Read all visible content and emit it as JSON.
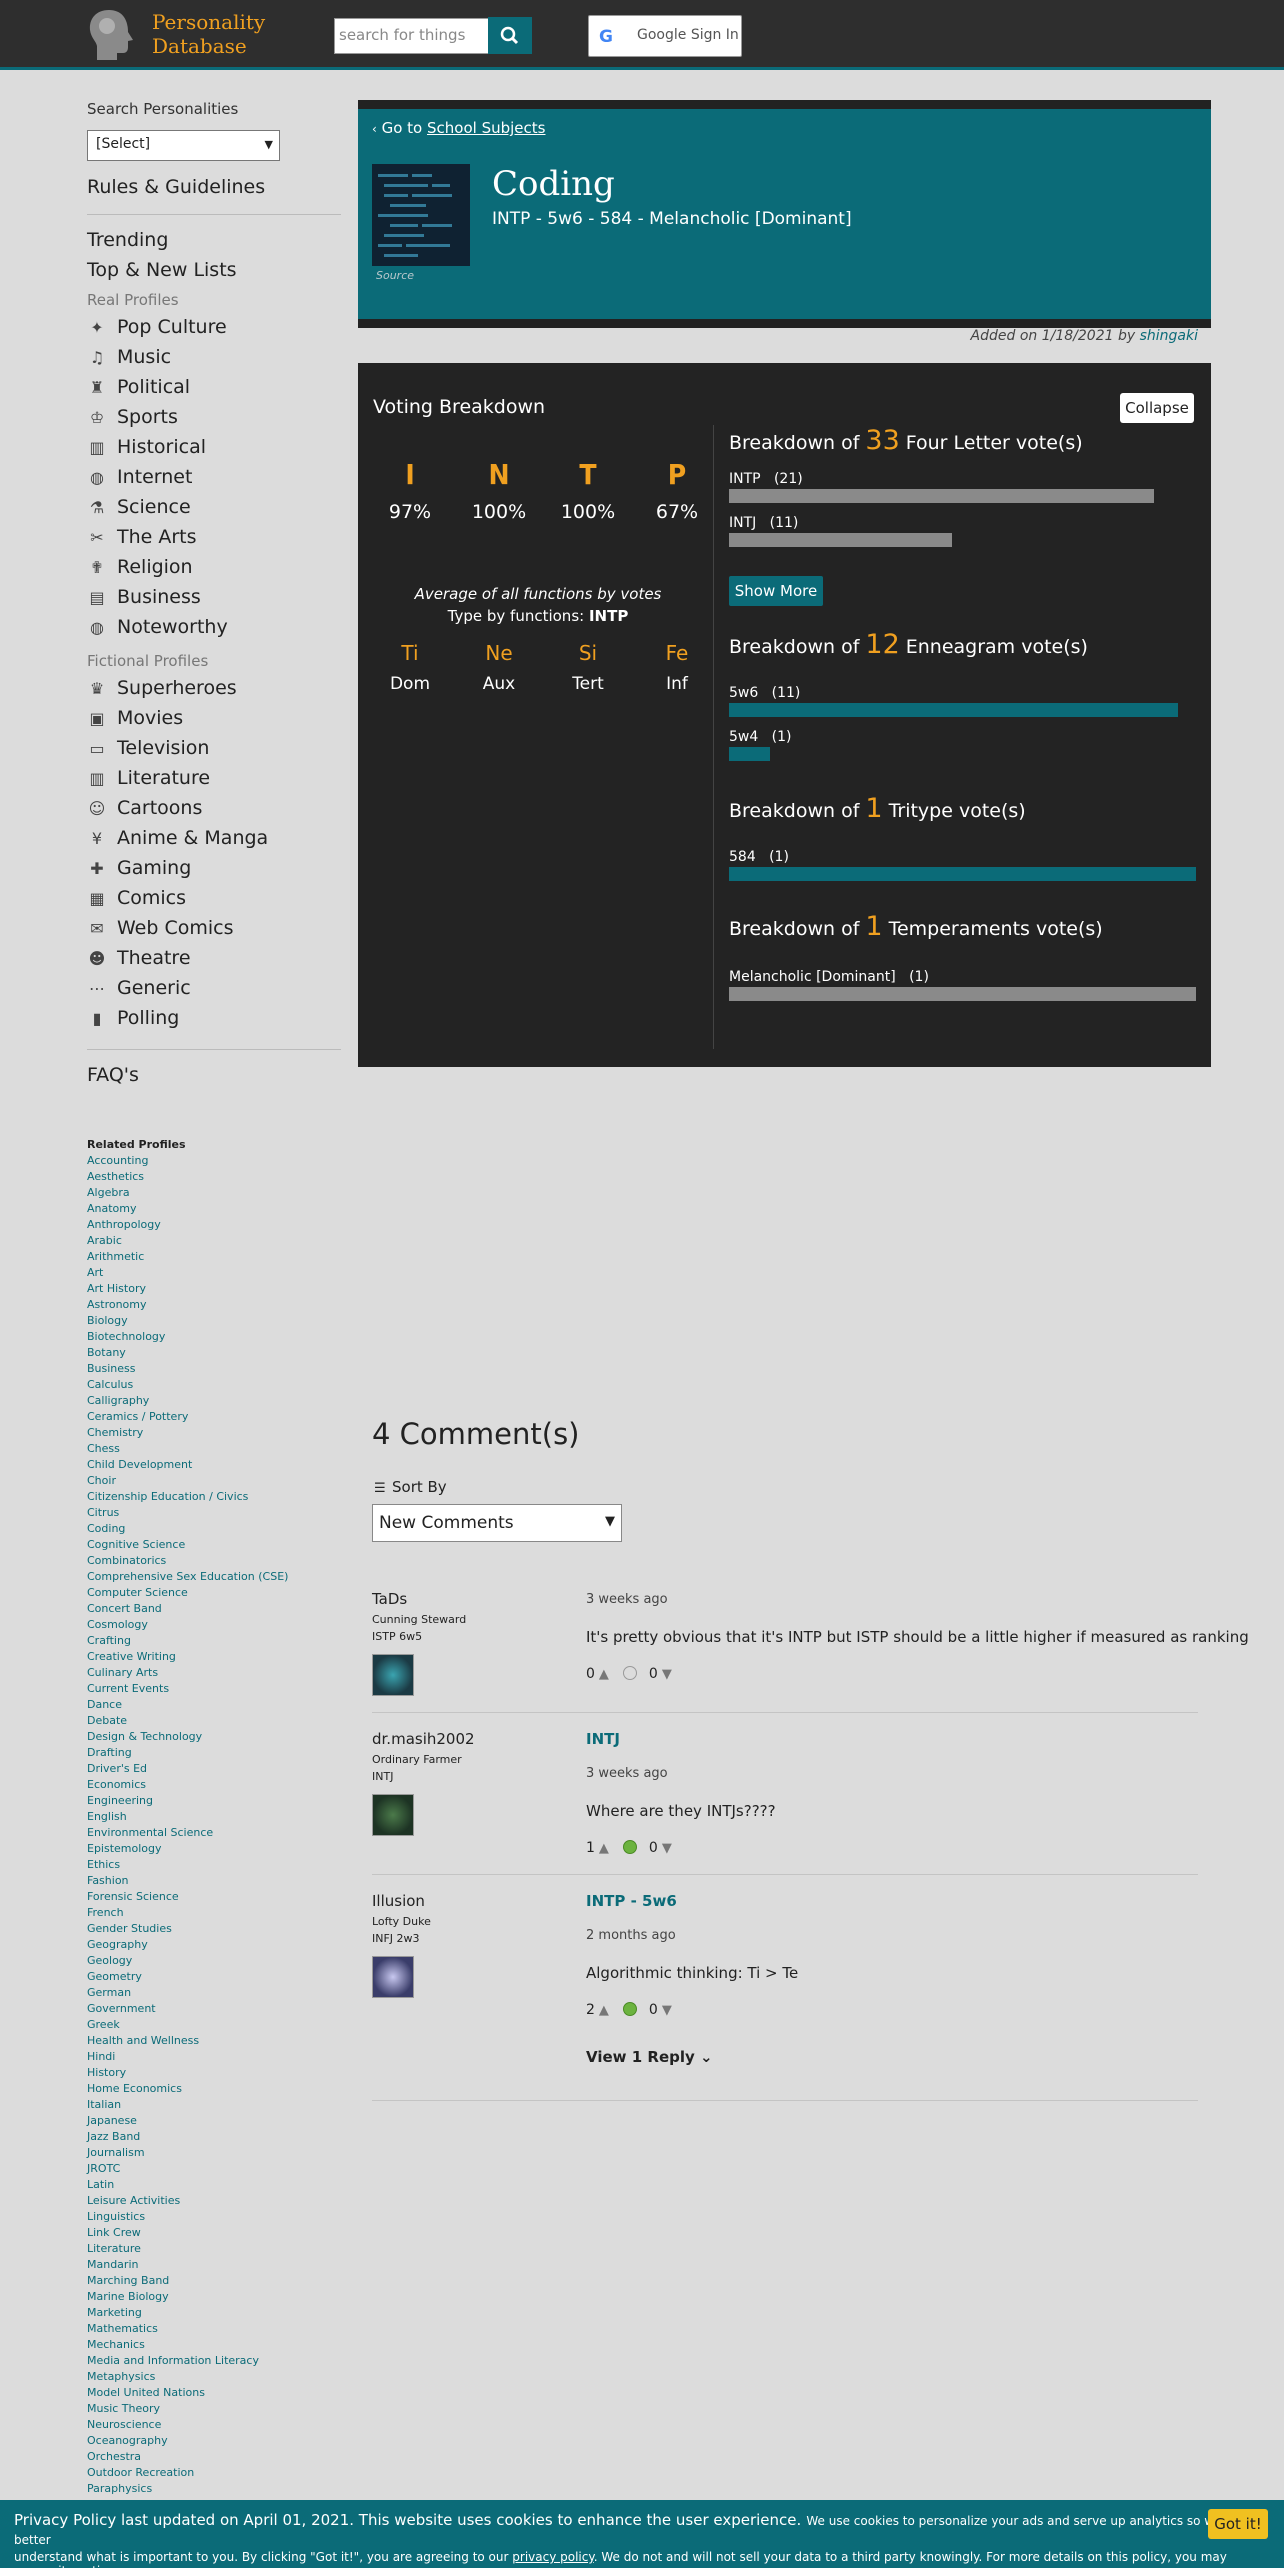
{
  "header": {
    "logo_line1": "Personality",
    "logo_line2": "Database",
    "search_placeholder": "search for things",
    "google_sign_in": "Google Sign In"
  },
  "sidebar": {
    "search_label": "Search Personalities",
    "select_value": "[Select]",
    "rules": "Rules & Guidelines",
    "trending": "Trending",
    "top_lists": "Top & New Lists",
    "real_head": "Real Profiles",
    "real_items": [
      "Pop Culture",
      "Music",
      "Political",
      "Sports",
      "Historical",
      "Internet",
      "Science",
      "The Arts",
      "Religion",
      "Business",
      "Noteworthy"
    ],
    "fiction_head": "Fictional Profiles",
    "fiction_items": [
      "Superheroes",
      "Movies",
      "Television",
      "Literature",
      "Cartoons",
      "Anime & Manga",
      "Gaming",
      "Comics",
      "Web Comics",
      "Theatre",
      "Generic",
      "Polling"
    ],
    "faq": "FAQ's",
    "related_title": "Related Profiles",
    "related": [
      "Accounting",
      "Aesthetics",
      "Algebra",
      "Anatomy",
      "Anthropology",
      "Arabic",
      "Arithmetic",
      "Art",
      "Art History",
      "Astronomy",
      "Biology",
      "Biotechnology",
      "Botany",
      "Business",
      "Calculus",
      "Calligraphy",
      "Ceramics / Pottery",
      "Chemistry",
      "Chess",
      "Child Development",
      "Choir",
      "Citizenship Education / Civics",
      "Citrus",
      "Coding",
      "Cognitive Science",
      "Combinatorics",
      "Comprehensive Sex Education (CSE)",
      "Computer Science",
      "Concert Band",
      "Cosmology",
      "Crafting",
      "Creative Writing",
      "Culinary Arts",
      "Current Events",
      "Dance",
      "Debate",
      "Design & Technology",
      "Drafting",
      "Driver's Ed",
      "Economics",
      "Engineering",
      "English",
      "Environmental Science",
      "Epistemology",
      "Ethics",
      "Fashion",
      "Forensic Science",
      "French",
      "Gender Studies",
      "Geography",
      "Geology",
      "Geometry",
      "German",
      "Government",
      "Greek",
      "Health and Wellness",
      "Hindi",
      "History",
      "Home Economics",
      "Italian",
      "Japanese",
      "Jazz Band",
      "Journalism",
      "JROTC",
      "Latin",
      "Leisure Activities",
      "Linguistics",
      "Link Crew",
      "Literature",
      "Mandarin",
      "Marching Band",
      "Marine Biology",
      "Marketing",
      "Mathematics",
      "Mechanics",
      "Media and Information Literacy",
      "Metaphysics",
      "Model United Nations",
      "Music Theory",
      "Neuroscience",
      "Oceanography",
      "Orchestra",
      "Outdoor Recreation",
      "Paraphysics"
    ]
  },
  "profile": {
    "goto_prefix": "Go to",
    "goto_link": "School Subjects",
    "source": "Source",
    "name": "Coding",
    "types": "INTP - 5w6 - 584 - Melancholic [Dominant]",
    "added_prefix": "Added on 1/18/2021 by",
    "added_by": "shingaki"
  },
  "voting": {
    "title": "Voting Breakdown",
    "collapse": "Collapse",
    "letters": [
      {
        "l": "I",
        "p": "97%"
      },
      {
        "l": "N",
        "p": "100%"
      },
      {
        "l": "T",
        "p": "100%"
      },
      {
        "l": "P",
        "p": "67%"
      }
    ],
    "avg": "Average of all functions by votes",
    "type_by_prefix": "Type by functions:",
    "type_by": "INTP",
    "functions": [
      {
        "f": "Ti",
        "r": "Dom"
      },
      {
        "f": "Ne",
        "r": "Aux"
      },
      {
        "f": "Si",
        "r": "Tert"
      },
      {
        "f": "Fe",
        "r": "Inf"
      }
    ],
    "bd_prefix": "Breakdown of",
    "four": {
      "count": "33",
      "label": "Four Letter vote(s)",
      "rows": [
        {
          "name": "INTP",
          "votes": "(21)",
          "value": 21
        },
        {
          "name": "INTJ",
          "votes": "(11)",
          "value": 11
        }
      ],
      "show_more": "Show More"
    },
    "ennea": {
      "count": "12",
      "label": "Enneagram vote(s)",
      "rows": [
        {
          "name": "5w6",
          "votes": "(11)",
          "value": 11
        },
        {
          "name": "5w4",
          "votes": "(1)",
          "value": 1
        }
      ]
    },
    "tritype": {
      "count": "1",
      "label": "Tritype vote(s)",
      "rows": [
        {
          "name": "584",
          "votes": "(1)",
          "value": 1
        }
      ]
    },
    "temper": {
      "count": "1",
      "label": "Temperaments vote(s)",
      "rows": [
        {
          "name": "Melancholic [Dominant]",
          "votes": "(1)",
          "value": 1
        }
      ]
    }
  },
  "comments": {
    "title": "4 Comment(s)",
    "sort_by": "Sort By",
    "sort_value": "New Comments",
    "items": [
      {
        "user": "TaDs",
        "role": "Cunning Steward",
        "type": "ISTP 6w5",
        "vote": "",
        "time": "3 weeks ago",
        "text": "It's pretty obvious that it's INTP but ISTP should be a little higher if measured as ranking",
        "up": "0",
        "down": "0"
      },
      {
        "user": "dr.masih2002",
        "role": "Ordinary Farmer",
        "type": "INTJ",
        "vote": "INTJ",
        "time": "3 weeks ago",
        "text": "Where are they INTJs????",
        "up": "1",
        "down": "0"
      },
      {
        "user": "Illusion",
        "role": "Lofty Duke",
        "type": "INFJ 2w3",
        "vote": "INTP - 5w6",
        "time": "2 months ago",
        "text": "Algorithmic thinking: Ti > Te",
        "up": "2",
        "down": "0",
        "reply": "View 1 Reply"
      }
    ]
  },
  "cookie": {
    "big": "Privacy Policy last updated on April 01, 2021. This website uses cookies to enhance the user experience.",
    "small1": "We use cookies to personalize your ads and serve up analytics so we can better",
    "small2": "understand what is important to you. By clicking \"Got it!\", you are agreeing to our",
    "link": "privacy policy",
    "small3": ". We do not and will not sell your data to a third party knowingly. For more details on this policy, you may access it anytime.",
    "got_it": "Got it!"
  },
  "colors": {
    "teal": "#0b6b78",
    "orange": "#f0a020",
    "dark": "#232323",
    "gray_bar": "#8a8a8a"
  },
  "icons": {
    "search": "magnifier-icon",
    "real": [
      "pop-culture-icon",
      "music-note-icon",
      "political-icon",
      "medal-icon",
      "column-icon",
      "globe-icon",
      "flask-icon",
      "brushes-icon",
      "religion-icon",
      "briefcase-icon",
      "globe-icon"
    ],
    "fiction": [
      "mask-icon",
      "film-icon",
      "tv-icon",
      "book-icon",
      "cartoon-icon",
      "yen-icon",
      "gamepad-icon",
      "comic-icon",
      "chat-icon",
      "theatre-icon",
      "dots-icon",
      "bar-chart-icon"
    ]
  }
}
